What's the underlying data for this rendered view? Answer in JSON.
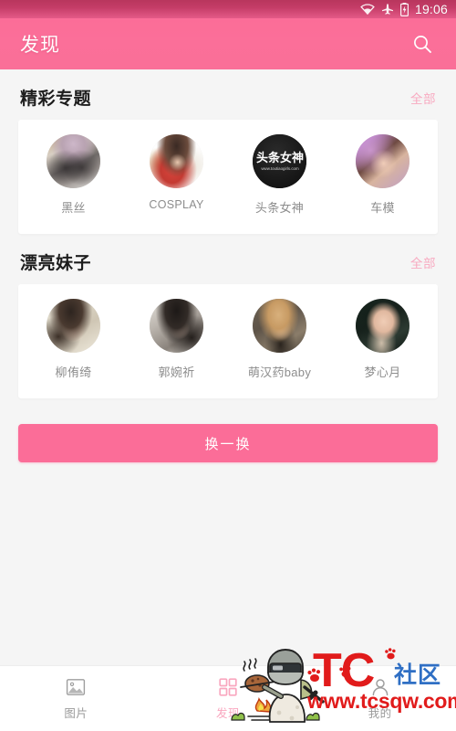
{
  "status_bar": {
    "time": "19:06",
    "icons": [
      "wifi-icon",
      "airplane-mode-icon",
      "battery-charging-icon"
    ]
  },
  "app_bar": {
    "title": "发现",
    "search_icon": "search-icon"
  },
  "sections": [
    {
      "title": "精彩专题",
      "more_label": "全部",
      "items": [
        {
          "label": "黑丝",
          "avatar": "avatar-heisi"
        },
        {
          "label": "COSPLAY",
          "avatar": "avatar-cosplay"
        },
        {
          "label": "头条女神",
          "avatar": "avatar-toutiao-nvshen"
        },
        {
          "label": "车模",
          "avatar": "avatar-chemo"
        }
      ]
    },
    {
      "title": "漂亮妹子",
      "more_label": "全部",
      "items": [
        {
          "label": "柳侑绮",
          "avatar": "avatar-liuyouqi"
        },
        {
          "label": "郭婉祈",
          "avatar": "avatar-guowanqi"
        },
        {
          "label": "萌汉药baby",
          "avatar": "avatar-menghanyao-baby"
        },
        {
          "label": "梦心月",
          "avatar": "avatar-mengxinyue"
        }
      ]
    }
  ],
  "refresh_button": {
    "label": "换一换"
  },
  "bottom_nav": {
    "tabs": [
      {
        "label": "图片",
        "icon": "image-icon",
        "active": false
      },
      {
        "label": "发现",
        "icon": "discover-grid-icon",
        "active": true
      },
      {
        "label": "我的",
        "icon": "person-icon",
        "active": false
      }
    ]
  },
  "watermark": {
    "brand": "TC",
    "brand_suffix": "社区",
    "url": "www.tcsqw.com",
    "mascot": "soldier-cooking-icon"
  },
  "colors": {
    "accent_pink": "#fb6d98",
    "status_bar": "#c43c67",
    "page_background": "#f5f5f5",
    "card_background": "#ffffff",
    "more_link": "#f8a9c0",
    "label_gray": "#8d8d8d",
    "watermark_red": "#e11b1b",
    "watermark_blue": "#2f6fc4"
  }
}
